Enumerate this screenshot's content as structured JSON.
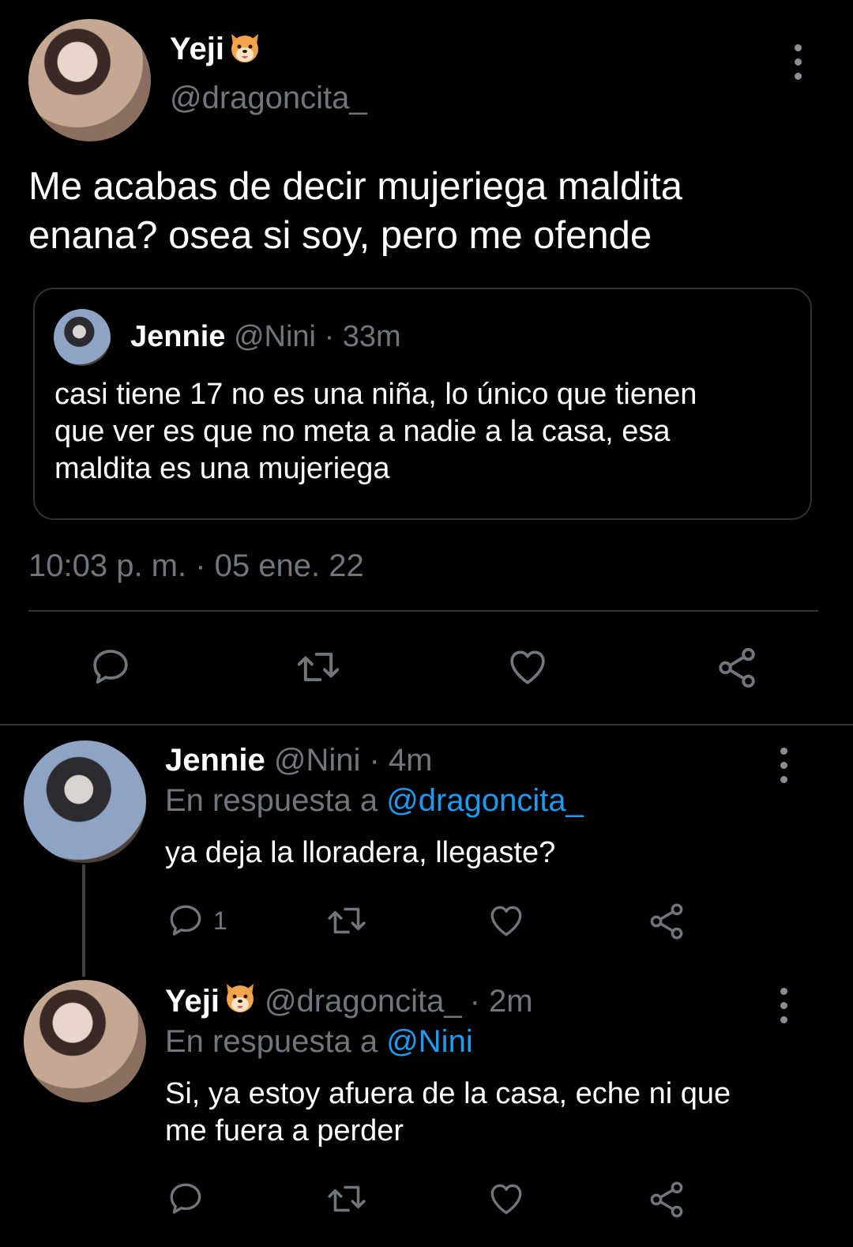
{
  "main_tweet": {
    "author_name": "Yeji",
    "author_handle": "@dragoncita_",
    "text_line1": "Me acabas de decir mujeriega maldita",
    "text_line2": "enana? osea si soy, pero me ofende",
    "timestamp": "10:03 p. m. · 05 ene. 22"
  },
  "quoted_tweet": {
    "author_name": "Jennie",
    "author_handle": "@Nini",
    "time": "· 33m",
    "text_line1": "casi tiene 17 no es una niña, lo único que tienen",
    "text_line2": "que ver es que no meta a nadie a la casa, esa",
    "text_line3": "maldita es una mujeriega"
  },
  "reply1": {
    "author_name": "Jennie",
    "author_handle": "@Nini",
    "time": "· 4m",
    "reply_prefix": "En respuesta a",
    "reply_to": "@dragoncita_",
    "text": "ya deja la lloradera, llegaste?",
    "reply_count": "1"
  },
  "reply2": {
    "author_name": "Yeji",
    "author_handle": "@dragoncita_",
    "time": "· 2m",
    "reply_prefix": "En respuesta a",
    "reply_to": "@Nini",
    "text_line1": "Si, ya estoy afuera de la casa, eche ni que",
    "text_line2": "me fuera a perder"
  },
  "icons": {
    "reply": "reply-icon",
    "retweet": "retweet-icon",
    "like": "heart-icon",
    "share": "share-icon",
    "more": "more-vertical-icon",
    "emoji": "dog-face-emoji"
  },
  "colors": {
    "background": "#000000",
    "text": "#ffffff",
    "muted": "#71767b",
    "link": "#1d9bf0",
    "border": "#2f3336"
  }
}
